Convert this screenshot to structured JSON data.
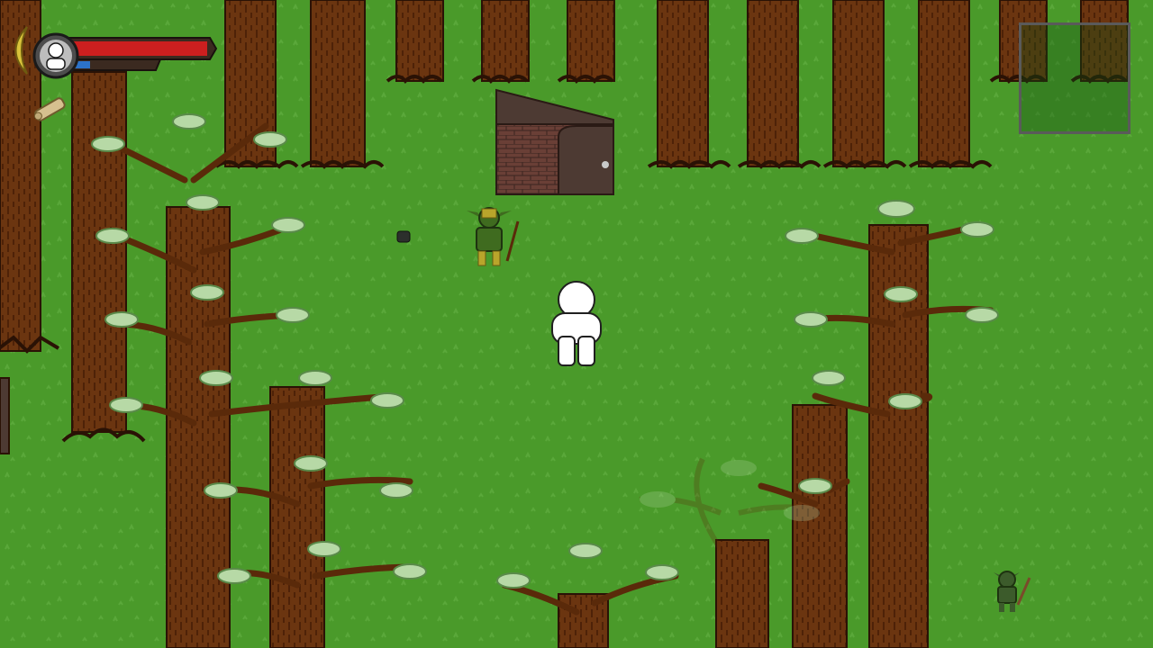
{
  "scene": {
    "grass_color": "#4a9a2a",
    "trunk_color": "#6b3510",
    "leaf_color": "#b7d9a6",
    "hut_color": "#4d3a33"
  },
  "player": {
    "name": "player-character",
    "color": "#ffffff"
  },
  "enemies": [
    {
      "name": "goblin-with-staff",
      "color": "#3f6b1f"
    },
    {
      "name": "goblin-distant",
      "color": "#3c5b2b"
    }
  ],
  "hud": {
    "portrait_icon": "player-portrait-icon",
    "health_fraction": 1.0,
    "health_color": "#cc1f1f",
    "mana_color": "#2c72c8",
    "inventory_icon": "scroll-item-icon"
  },
  "minimap": {
    "icon": "minimap-icon",
    "border_color": "#5a5a5a"
  },
  "hut": {
    "icon": "brick-hut-icon"
  }
}
